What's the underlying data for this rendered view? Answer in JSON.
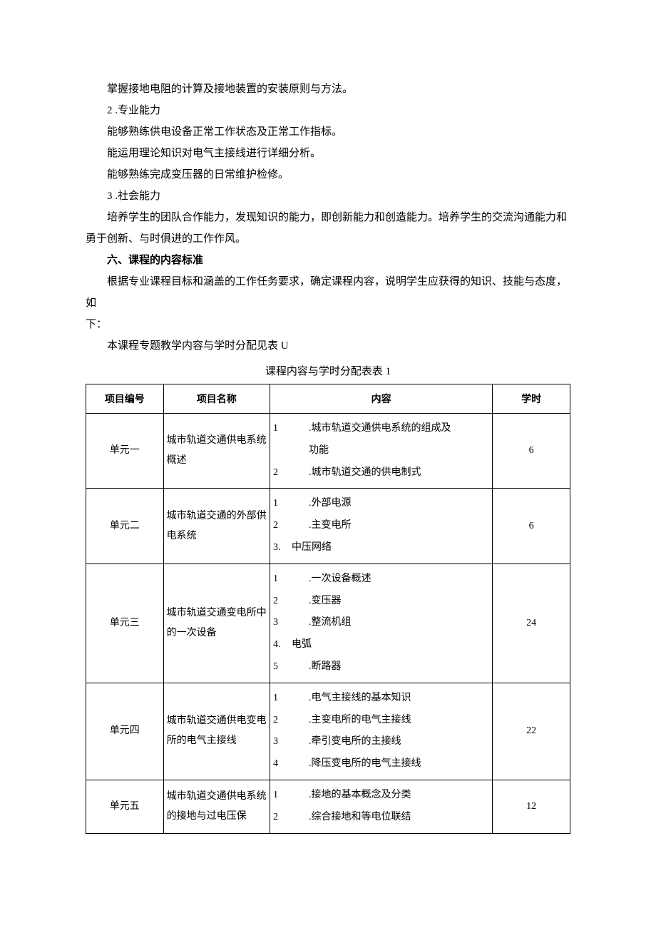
{
  "paragraphs": {
    "p1": "掌握接地电阻的计算及接地装置的安装原则与方法。",
    "p2_num": "2",
    "p2_title": " .专业能力",
    "p3": "能够熟练供电设备正常工作状态及正常工作指标。",
    "p4": "能运用理论知识对电气主接线进行详细分析。",
    "p5": "能够熟练完成变压器的日常维护检修。",
    "p6_num": "3",
    "p6_title": " .社会能力",
    "p7": "培养学生的团队合作能力，发现知识的能力，即创新能力和创造能力。培养学生的交流沟通能力和勇于创新、与时俱进的工作作风。",
    "h6": "六、课程的内容标准",
    "p8a": "根据专业课程目标和涵盖的工作任务要求，确定课程内容，说明学生应获得的知识、技能与态度，如",
    "p8b": "下：",
    "p9": "本课程专题教学内容与学时分配见表 U"
  },
  "table": {
    "caption": "课程内容与学时分配表表 1",
    "headers": {
      "id": "项目编号",
      "name": "项目名称",
      "content": "内容",
      "hours": "学时"
    },
    "rows": [
      {
        "id": "单元一",
        "name": "城市轨道交通供电系统概述",
        "content": [
          {
            "num": "1",
            "text": ".城市轨道交通供电系统的组成及",
            "cont": "功能",
            "style": "wide"
          },
          {
            "num": "2",
            "text": ".城市轨道交通的供电制式",
            "style": "wide"
          }
        ],
        "hours": "6"
      },
      {
        "id": "单元二",
        "name": "城市轨道交通的外部供电系统",
        "content": [
          {
            "num": "1",
            "text": ".外部电源",
            "style": "wide"
          },
          {
            "num": "2",
            "text": ".主变电所",
            "style": "wide"
          },
          {
            "num": "3.",
            "text": "中压网络",
            "style": "tight"
          }
        ],
        "hours": "6"
      },
      {
        "id": "单元三",
        "name": "城市轨道交通变电所中的一次设备",
        "content": [
          {
            "num": "1",
            "text": ".一次设备概述",
            "style": "wide"
          },
          {
            "num": "2",
            "text": ".变压器",
            "style": "wide"
          },
          {
            "num": "3",
            "text": ".整流机组",
            "style": "wide"
          },
          {
            "num": "4.",
            "text": "电弧",
            "style": "tight"
          },
          {
            "num": "5",
            "text": ".断路器",
            "style": "wide"
          }
        ],
        "hours": "24"
      },
      {
        "id": "单元四",
        "name": "城市轨道交通供电变电所的电气主接线",
        "content": [
          {
            "num": "1",
            "text": ".电气主接线的基本知识",
            "style": "wide"
          },
          {
            "num": "2",
            "text": ".主变电所的电气主接线",
            "style": "wide"
          },
          {
            "num": "3",
            "text": ".牵引变电所的主接线",
            "style": "wide"
          },
          {
            "num": "4",
            "text": ".降压变电所的电气主接线",
            "style": "wide"
          }
        ],
        "hours": "22"
      },
      {
        "id": "单元五",
        "name": "城市轨道交通供电系统的接地与过电压保",
        "content": [
          {
            "num": "1",
            "text": ".接地的基本概念及分类",
            "style": "wide"
          },
          {
            "num": "2",
            "text": ".综合接地和等电位联结",
            "style": "wide"
          }
        ],
        "hours": "12"
      }
    ]
  }
}
